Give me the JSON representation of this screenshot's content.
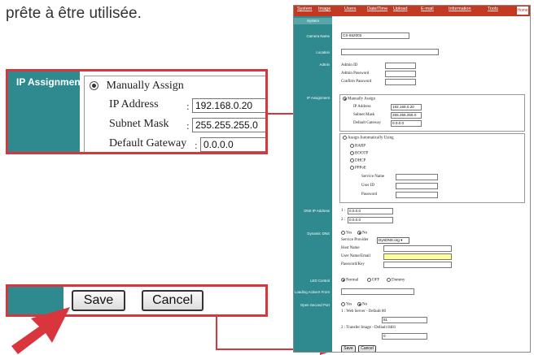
{
  "intro_text": "prête à être utilisée.",
  "zoom_ip": {
    "section_label": "IP Assignment",
    "manual_option": "Manually Assign",
    "ip_label": "IP Address",
    "ip_value": "192.168.0.20",
    "mask_label": "Subnet Mask",
    "mask_value": "255.255.255.0",
    "gateway_label": "Default Gateway",
    "gateway_value": "0.0.0.0",
    "colon": ":"
  },
  "zoom_buttons": {
    "save": "Save",
    "cancel": "Cancel"
  },
  "nav": {
    "items": [
      "System",
      "Image",
      "Users",
      "Date/Time",
      "Upload",
      "E-mail",
      "Information",
      "Tools"
    ],
    "home": "Home"
  },
  "screen": {
    "tab": "System",
    "camera_name_label": "Camera Name",
    "camera_name_value": "CS-552003",
    "location_label": "Location",
    "location_value": "",
    "admin_label": "Admin",
    "admin_id": "Admin ID",
    "admin_password": "Admin Password",
    "confirm_password": "Confirm Password",
    "ip_assignment_label": "IP Assignment",
    "manual": "Manually Assign",
    "ip_address": "IP Address",
    "ip_value": "192.168.0.20",
    "subnet_mask": "Subnet Mask",
    "subnet_value": "255.255.255.0",
    "default_gateway": "Default Gateway",
    "gateway_value": "0.0.0.0",
    "auto": "Assign Automatically Using",
    "rarp": "RARP",
    "bootp": "BOOTP",
    "dhcp": "DHCP",
    "pppoe": "PPPoE",
    "service_name": "Service Name",
    "user_id": "User ID",
    "password": "Password",
    "dns_label": "DNS IP Address",
    "dns1_prefix": "1 :",
    "dns1_value": "0.0.0.0",
    "dns2_prefix": "2 :",
    "dns2_value": "0.0.0.0",
    "dyn_label": "Dynamic DNS",
    "yes": "Yes",
    "no": "No",
    "service_provider": "Service Provider",
    "provider_value": "DynDNS.org",
    "host_name": "Host Name",
    "user_name": "User Name/Email",
    "password_key": "Password/Key",
    "led_label": "LED Control",
    "normal": "Normal",
    "off": "OFF",
    "dummy": "Dummy",
    "loading_label": "Loading ActiveX From",
    "open_port_label": "Open Second Port",
    "web_server": "1 : Web Server  - Default 80",
    "web_value": "81",
    "transfer": "2 : Transfer Image - Default 8481",
    "transfer_value": "0",
    "save": "Save",
    "cancel": "Cancel"
  },
  "colors": {
    "accent_red": "#d9353c",
    "sidebar_teal": "#2f8a8f",
    "nav_red": "#c23a22",
    "highlight_yellow": "#ffff99"
  }
}
